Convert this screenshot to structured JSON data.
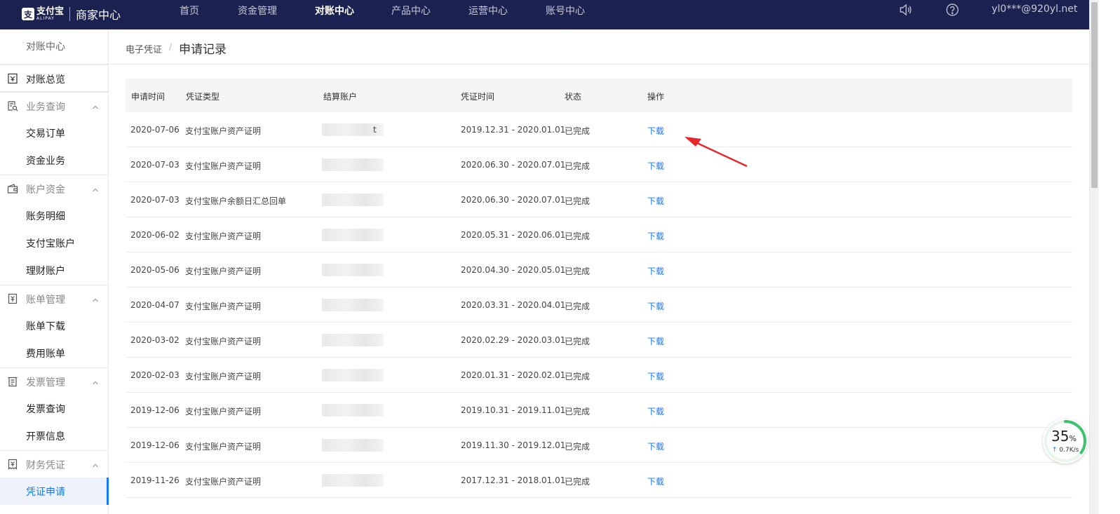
{
  "header": {
    "logo_cn": "支付宝",
    "logo_en": "ALIPAY",
    "title": "商家中心",
    "nav": [
      {
        "label": "首页",
        "active": false
      },
      {
        "label": "资金管理",
        "active": false
      },
      {
        "label": "对账中心",
        "active": true
      },
      {
        "label": "产品中心",
        "active": false
      },
      {
        "label": "运营中心",
        "active": false
      },
      {
        "label": "账号中心",
        "active": false
      }
    ],
    "user_email": "yl0***@920yl.net"
  },
  "sidebar": {
    "title": "对账中心",
    "items": [
      {
        "label": "对账总览",
        "type": "top",
        "icon": "reconcile-icon"
      },
      {
        "label": "业务查询",
        "type": "group",
        "icon": "search-doc-icon"
      },
      {
        "label": "交易订单",
        "type": "sub"
      },
      {
        "label": "资金业务",
        "type": "sub"
      },
      {
        "label": "账户资金",
        "type": "group",
        "icon": "wallet-icon"
      },
      {
        "label": "账务明细",
        "type": "sub"
      },
      {
        "label": "支付宝账户",
        "type": "sub"
      },
      {
        "label": "理财账户",
        "type": "sub"
      },
      {
        "label": "账单管理",
        "type": "group",
        "icon": "bill-icon"
      },
      {
        "label": "账单下载",
        "type": "sub"
      },
      {
        "label": "费用账单",
        "type": "sub"
      },
      {
        "label": "发票管理",
        "type": "group",
        "icon": "invoice-icon"
      },
      {
        "label": "发票查询",
        "type": "sub"
      },
      {
        "label": "开票信息",
        "type": "sub"
      },
      {
        "label": "财务凭证",
        "type": "group",
        "icon": "voucher-icon"
      },
      {
        "label": "凭证申请",
        "type": "sub",
        "active": true
      }
    ]
  },
  "breadcrumb": {
    "parent": "电子凭证",
    "separator": "/",
    "current": "申请记录"
  },
  "table": {
    "columns": [
      "申请时间",
      "凭证类型",
      "结算账户",
      "凭证时间",
      "状态",
      "操作"
    ],
    "rows": [
      {
        "date": "2020-07-06",
        "type": "支付宝账户资产证明",
        "account": "t",
        "period": "2019.12.31 - 2020.01.01",
        "status": "已完成",
        "action": "下载"
      },
      {
        "date": "2020-07-03",
        "type": "支付宝账户资产证明",
        "account": "",
        "period": "2020.06.30 - 2020.07.01",
        "status": "已完成",
        "action": "下载"
      },
      {
        "date": "2020-07-03",
        "type": "支付宝账户余额日汇总回单",
        "account": "",
        "period": "2020.06.30 - 2020.07.01",
        "status": "已完成",
        "action": "下载"
      },
      {
        "date": "2020-06-02",
        "type": "支付宝账户资产证明",
        "account": "",
        "period": "2020.05.31 - 2020.06.01",
        "status": "已完成",
        "action": "下载"
      },
      {
        "date": "2020-05-06",
        "type": "支付宝账户资产证明",
        "account": "",
        "period": "2020.04.30 - 2020.05.01",
        "status": "已完成",
        "action": "下载"
      },
      {
        "date": "2020-04-07",
        "type": "支付宝账户资产证明",
        "account": "",
        "period": "2020.03.31 - 2020.04.01",
        "status": "已完成",
        "action": "下载"
      },
      {
        "date": "2020-03-02",
        "type": "支付宝账户资产证明",
        "account": "",
        "period": "2020.02.29 - 2020.03.01",
        "status": "已完成",
        "action": "下载"
      },
      {
        "date": "2020-02-03",
        "type": "支付宝账户资产证明",
        "account": "",
        "period": "2020.01.31 - 2020.02.01",
        "status": "已完成",
        "action": "下载"
      },
      {
        "date": "2019-12-06",
        "type": "支付宝账户资产证明",
        "account": "",
        "period": "2019.10.31 - 2019.11.01",
        "status": "已完成",
        "action": "下载"
      },
      {
        "date": "2019-12-06",
        "type": "支付宝账户资产证明",
        "account": "",
        "period": "2019.11.30 - 2019.12.01",
        "status": "已完成",
        "action": "下载"
      },
      {
        "date": "2019-11-26",
        "type": "支付宝账户资产证明",
        "account": "",
        "period": "2017.12.31 - 2018.01.01",
        "status": "已完成",
        "action": "下载"
      }
    ]
  },
  "speed_widget": {
    "percent": "35",
    "percent_unit": "%",
    "arrow": "↑",
    "rate": "0.7K/s",
    "progress": 0.35
  },
  "colors": {
    "header_bg": "#1b2151",
    "accent": "#1677ff",
    "annotation_arrow": "#e8262a",
    "speed_ring": "#3cc46b"
  }
}
